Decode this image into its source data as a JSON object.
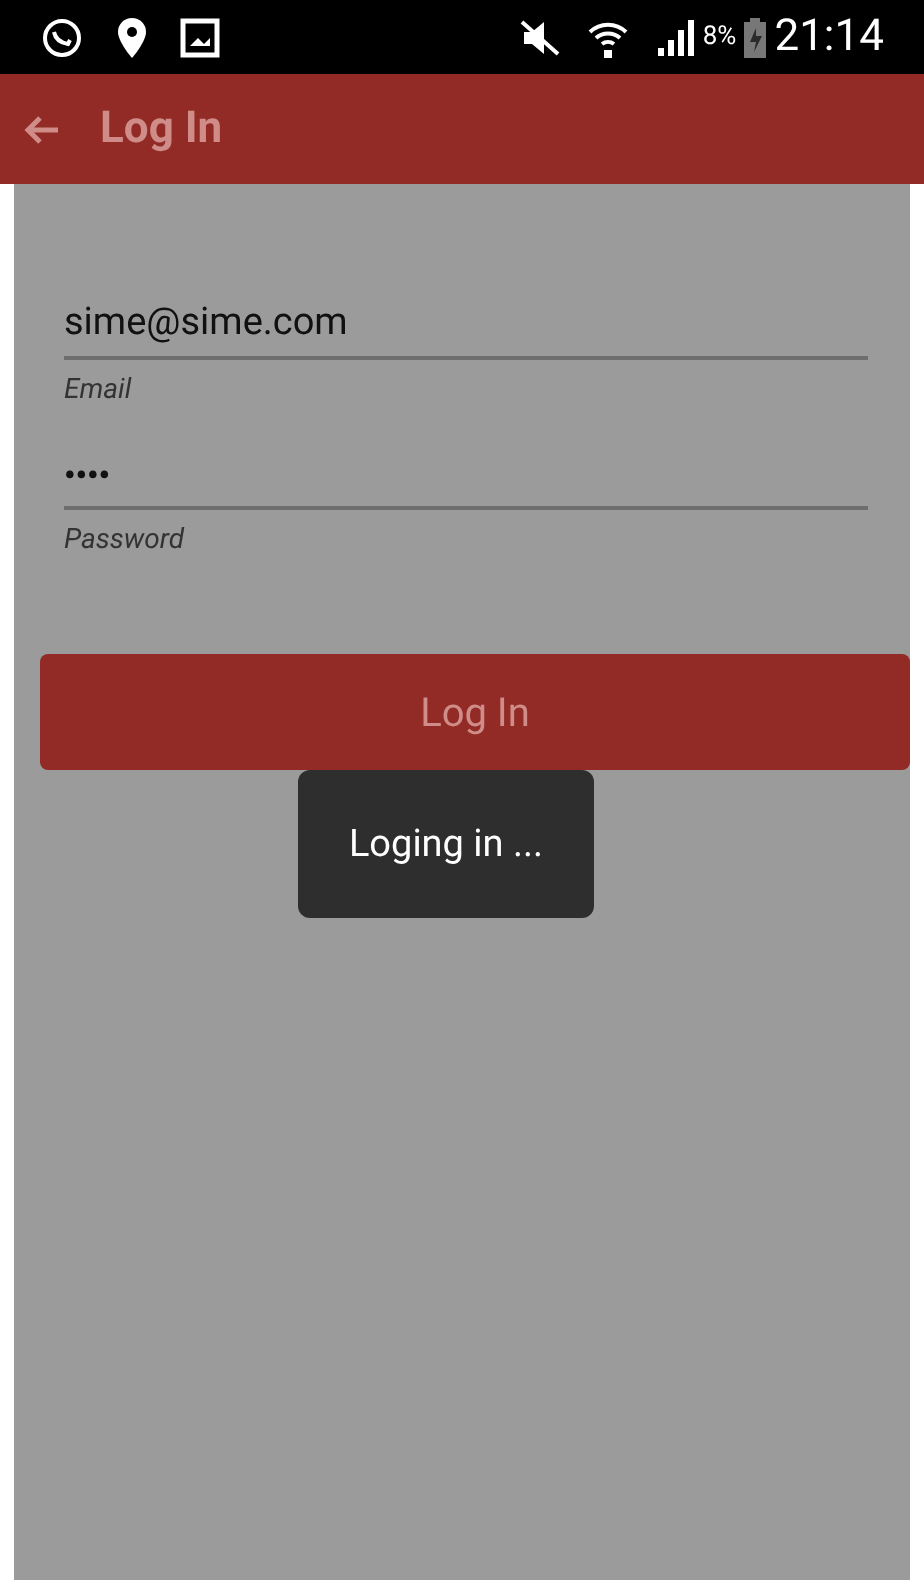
{
  "status_bar": {
    "battery_percent": "8%",
    "time": "21:14"
  },
  "app_bar": {
    "title": "Log In"
  },
  "fields": [
    {
      "value": "sime@sime.com",
      "label": "Email",
      "kind": "text"
    },
    {
      "value": "••••",
      "label": "Password",
      "kind": "password"
    }
  ],
  "button": {
    "label": "Log In"
  },
  "toast": {
    "message": "Loging in ..."
  }
}
